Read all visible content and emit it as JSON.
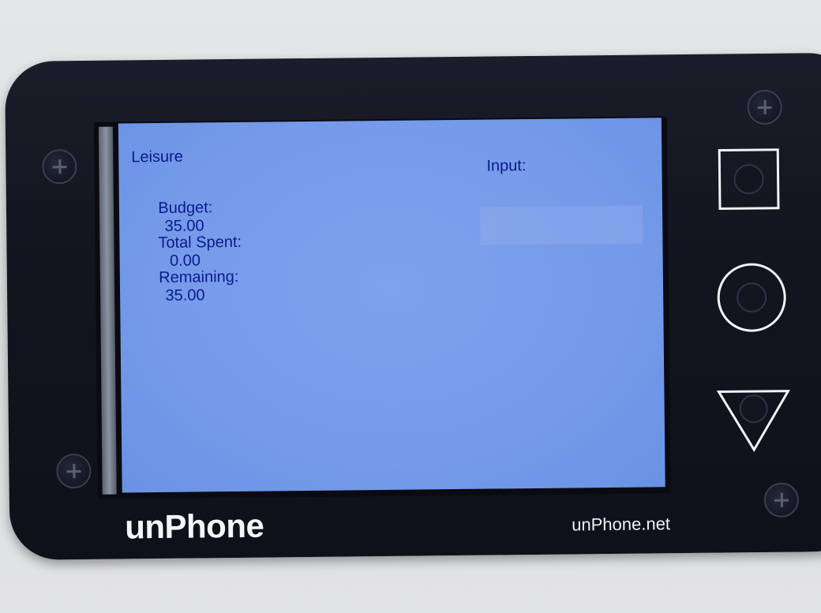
{
  "screen": {
    "category": "Leisure",
    "budget_label": "Budget:",
    "budget_value": "35.00",
    "spent_label": "Total Spent:",
    "spent_value": "0.00",
    "remaining_label": "Remaining:",
    "remaining_value": "35.00",
    "input_label": "Input:",
    "input_value": "0"
  },
  "device": {
    "brand": "unPhone",
    "website": "unPhone.net",
    "buttons": [
      "square",
      "circle",
      "triangle"
    ]
  },
  "colors": {
    "screen_bg": "#769bea",
    "screen_text": "#0b1a8c",
    "case": "#12141f",
    "brand_text": "#f4f5f7"
  }
}
